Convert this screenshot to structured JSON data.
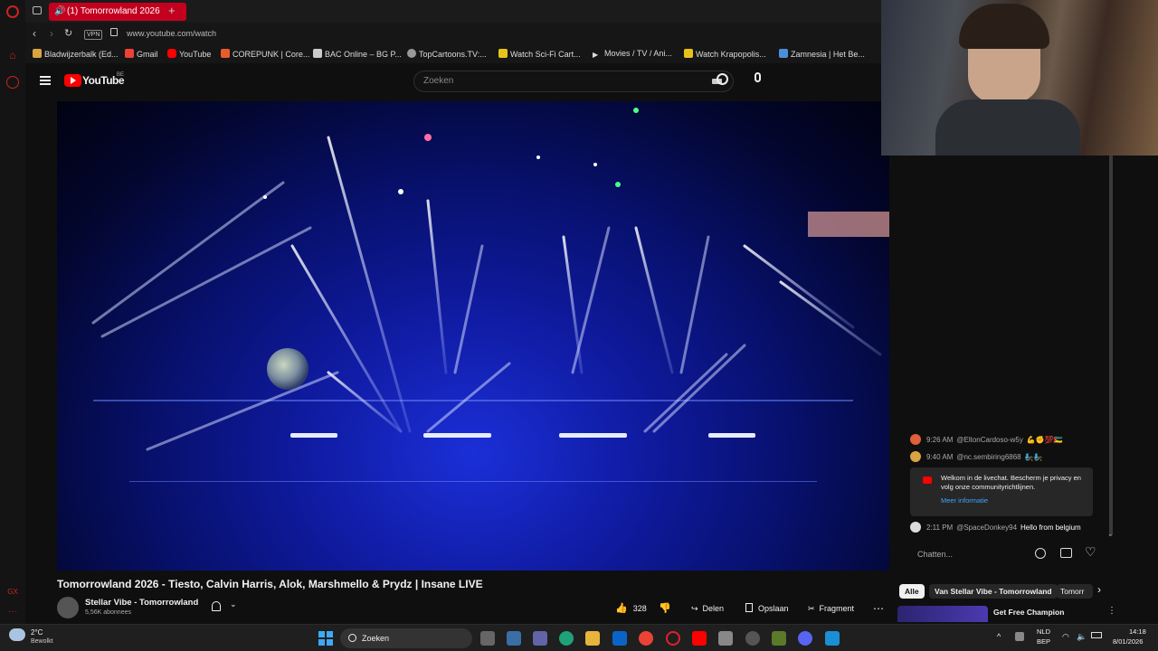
{
  "browser": {
    "tab_title": "(1) Tomorrowland 2026",
    "new_tab_symbol": "+",
    "vpn_label": "VPN",
    "url": "www.youtube.com/watch",
    "bookmarks": [
      {
        "label": "Bladwijzerbalk (Ed...",
        "color": "#d9a441"
      },
      {
        "label": "Gmail",
        "color": "#ea4335"
      },
      {
        "label": "YouTube",
        "color": "#ff0000"
      },
      {
        "label": "COREPUNK | Core...",
        "color": "#e65c2e"
      },
      {
        "label": "BAC Online – BG P...",
        "color": "#cccccc"
      },
      {
        "label": "TopCartoons.TV:...",
        "color": "#999999"
      },
      {
        "label": "Watch Sci-Fi Cart...",
        "color": "#e8c21c"
      },
      {
        "label": "Movies / TV / Ani...",
        "color": "#dddddd"
      },
      {
        "label": "Watch Krapopolis...",
        "color": "#e8c21c"
      },
      {
        "label": "Zamnesia | Het Be...",
        "color": "#4a90d9"
      }
    ]
  },
  "youtube": {
    "logo_text": "YouTube",
    "region": "BE",
    "search_placeholder": "Zoeken"
  },
  "video": {
    "title": "Tomorrowland 2026 - Tiesto, Calvin Harris, Alok, Marshmello & Prydz | Insane LIVE",
    "channel": "Stellar Vibe - Tomorrowland",
    "subscribers": "5,56K abonnees",
    "likes": "328",
    "share_label": "Delen",
    "save_label": "Opslaan",
    "clip_label": "Fragment"
  },
  "chat": {
    "messages": [
      {
        "time": "9:26 AM",
        "user": "@EltonCardoso-w5y",
        "text": "💪✊💯🇲🇿",
        "color": "#e0603a"
      },
      {
        "time": "9:40 AM",
        "user": "@nc.sembiring6868",
        "text": "🧞🧞",
        "color": "#d9a441"
      },
      {
        "time": "2:11 PM",
        "user": "@SpaceDonkey94",
        "text": "Hello from belgium",
        "color": "#dddddd"
      }
    ],
    "welcome_text": "Welkom in de livechat. Bescherm je privacy en volg onze communityrichtlijnen.",
    "learn_more": "Meer informatie",
    "input_placeholder": "Chatten..."
  },
  "recommendations": {
    "chips": [
      "Alle",
      "Van Stellar Vibe - Tomorrowland",
      "Tomorr"
    ],
    "next_title": "Get Free Champion"
  },
  "taskbar": {
    "weather_temp": "2°C",
    "weather_desc": "Bewolkt",
    "search_label": "Zoeken",
    "lang": "NLD",
    "layout": "BEP",
    "time": "14:18",
    "date": "8/01/2026"
  }
}
